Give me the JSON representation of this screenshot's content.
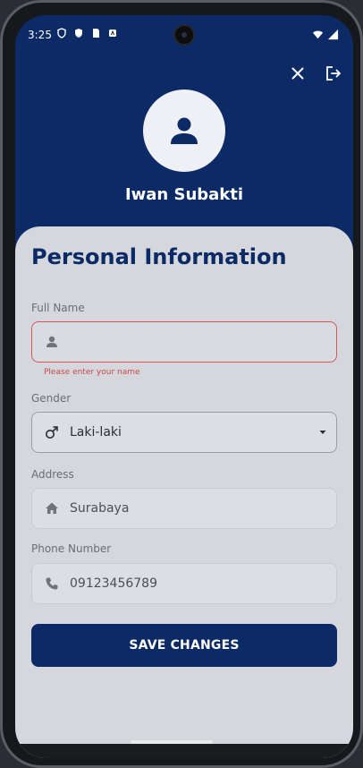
{
  "status_bar": {
    "time": "3:25"
  },
  "header": {
    "close_icon": "close-icon",
    "logout_icon": "logout-icon",
    "profile_name": "Iwan Subakti",
    "avatar_icon": "person-icon"
  },
  "form": {
    "title": "Personal Information",
    "full_name": {
      "label": "Full Name",
      "value": "",
      "placeholder": "",
      "error": "Please enter your name",
      "icon": "person-icon"
    },
    "gender": {
      "label": "Gender",
      "value": "Laki-laki",
      "icon": "male-icon"
    },
    "address": {
      "label": "Address",
      "value": "Surabaya",
      "icon": "home-icon"
    },
    "phone": {
      "label": "Phone Number",
      "value": "09123456789",
      "icon": "phone-icon"
    },
    "save_label": "SAVE CHANGES"
  },
  "colors": {
    "primary": "#0b2a66",
    "error": "#c94a4a",
    "card": "#d5d7dd"
  }
}
